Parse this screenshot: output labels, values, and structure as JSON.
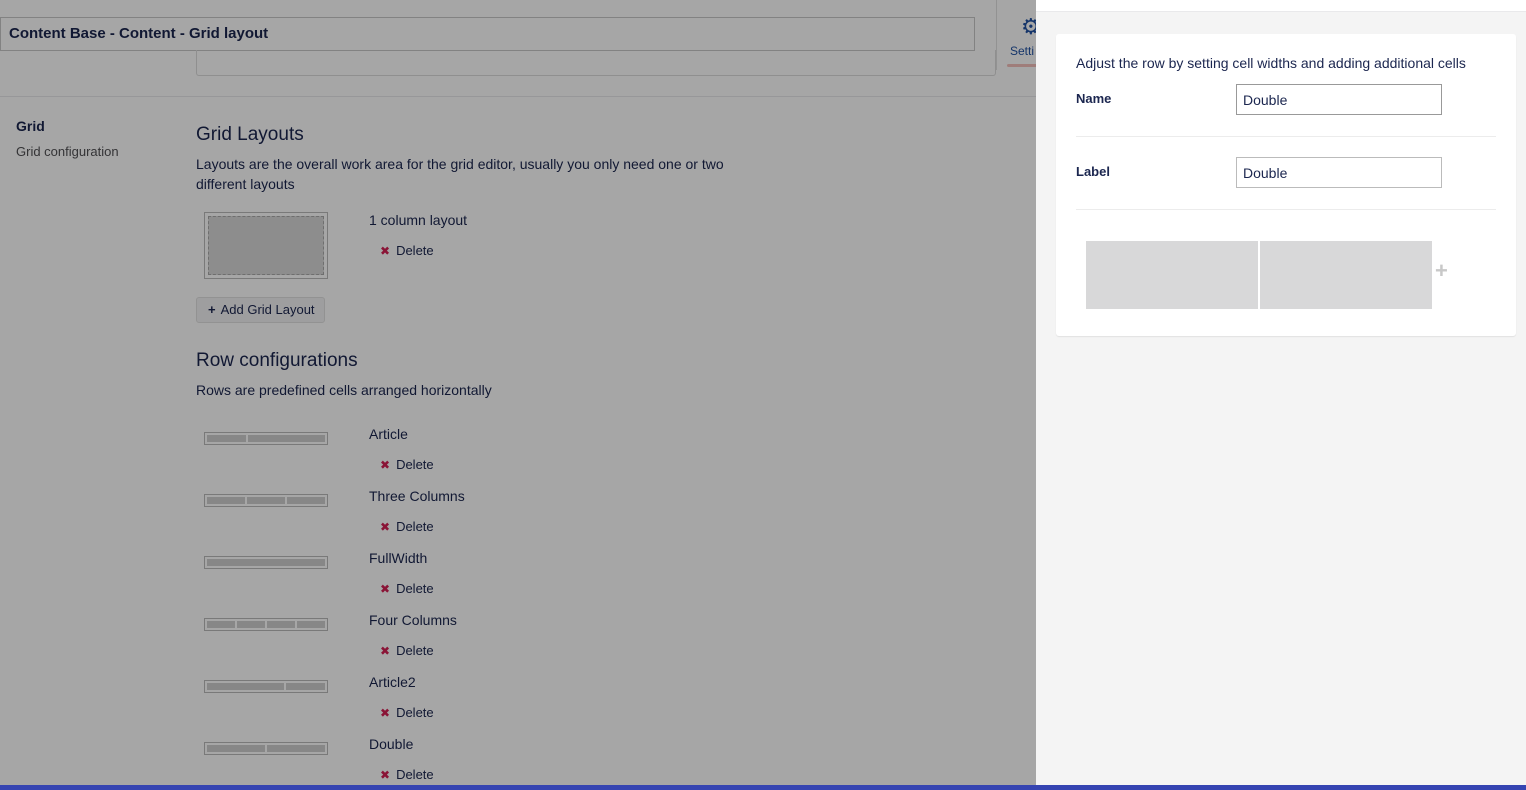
{
  "header": {
    "title": "Content Base - Content - Grid layout",
    "settings_tab": "Setti",
    "settings_icon": "gear-icon"
  },
  "left": {
    "title": "Grid",
    "desc": "Grid configuration"
  },
  "grid_layouts": {
    "title": "Grid Layouts",
    "desc": "Layouts are the overall work area for the grid editor, usually you only need one or two different layouts",
    "items": [
      {
        "name": "1 column layout",
        "delete_label": "Delete"
      }
    ],
    "add_label": "Add Grid Layout"
  },
  "rows": {
    "title": "Row configurations",
    "desc": "Rows are predefined cells arranged horizontally",
    "items": [
      {
        "name": "Article",
        "delete_label": "Delete",
        "cells": [
          1,
          2
        ]
      },
      {
        "name": "Three Columns",
        "delete_label": "Delete",
        "cells": [
          1,
          1,
          1
        ]
      },
      {
        "name": "FullWidth",
        "delete_label": "Delete",
        "cells": [
          1
        ]
      },
      {
        "name": "Four Columns",
        "delete_label": "Delete",
        "cells": [
          1,
          1,
          1,
          1
        ]
      },
      {
        "name": "Article2",
        "delete_label": "Delete",
        "cells": [
          2,
          1
        ]
      },
      {
        "name": "Double",
        "delete_label": "Delete",
        "cells": [
          1,
          1
        ]
      }
    ]
  },
  "panel": {
    "desc": "Adjust the row by setting cell widths and adding additional cells",
    "name_label": "Name",
    "name_value": "Double",
    "label_label": "Label",
    "label_value": "Double",
    "cells": [
      1,
      1
    ],
    "add_cell_symbol": "+"
  },
  "colors": {
    "accent": "#3544b1",
    "delete": "#d42054",
    "text": "#1b264f"
  }
}
